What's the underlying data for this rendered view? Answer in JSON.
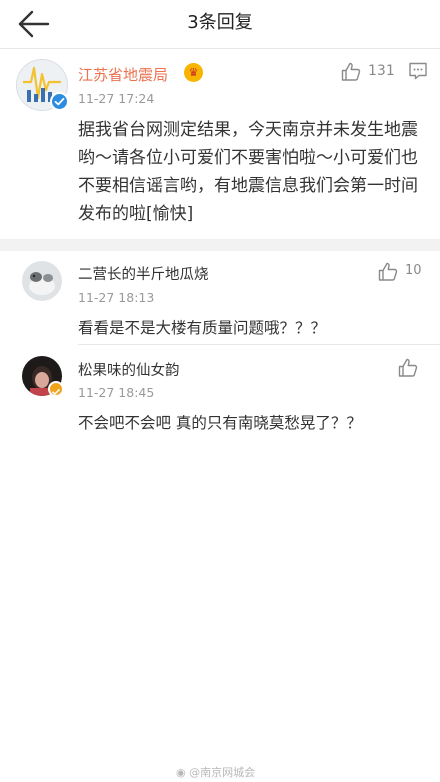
{
  "header": {
    "title": "3条回复"
  },
  "main_comment": {
    "author": "江苏省地震局",
    "timestamp": "11-27 17:24",
    "like_count": "131",
    "text": "据我省台网测定结果，今天南京并未发生地震哟～请各位小可爱们不要害怕啦～小可爱们也不要相信谣言哟，有地震信息我们会第一时间发布的啦[愉快]"
  },
  "replies": [
    {
      "author": "二营长的半斤地瓜烧",
      "timestamp": "11-27 18:13",
      "like_count": "10",
      "text": "看看是不是大楼有质量问题哦？？？"
    },
    {
      "author": "松果味的仙女韵",
      "timestamp": "11-27 18:45",
      "like_count": "",
      "text": "不会吧不会吧 真的只有南晓莫愁晃了？？"
    }
  ],
  "watermark": {
    "text": "@南京网城会"
  },
  "colors": {
    "author_main": "#eb7350",
    "verified": "#2b8de0",
    "member_badge": "#f7b500"
  }
}
